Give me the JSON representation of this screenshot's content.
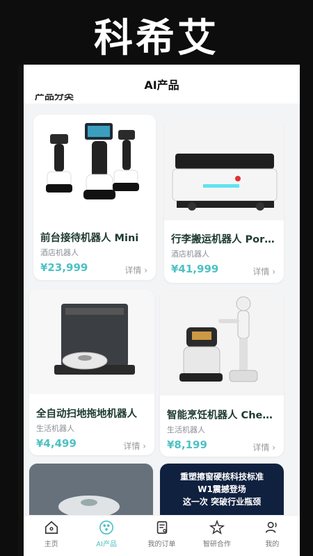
{
  "promo": {
    "title": "科希艾"
  },
  "header": {
    "title": "AI产品"
  },
  "section_peek": "产品分类",
  "colors": {
    "accent": "#4ec1c3",
    "name": "#1d3a2f"
  },
  "products": [
    {
      "name": "前台接待机器人 Mini",
      "category": "酒店机器人",
      "price": "¥23,999",
      "detail": "详情 ›"
    },
    {
      "name": "行李搬运机器人 Porter",
      "category": "酒店机器人",
      "price": "¥41,999",
      "detail": "详情 ›"
    },
    {
      "name": "全自动扫地拖地机器人",
      "category": "生活机器人",
      "price": "¥4,499",
      "detail": "详情 ›"
    },
    {
      "name": "智能烹饪机器人 Chef Pro",
      "category": "生活机器人",
      "price": "¥8,199",
      "detail": "详情 ›"
    }
  ],
  "banner": {
    "line1": "重塑擦窗硬核科技标准",
    "line2": "W1震撼登场",
    "line3": "这一次 突破行业瓶颈"
  },
  "tabs": [
    {
      "label": "主页",
      "icon": "home-icon"
    },
    {
      "label": "AI产品",
      "icon": "ai-products-icon"
    },
    {
      "label": "我的订单",
      "icon": "orders-icon"
    },
    {
      "label": "智研合作",
      "icon": "cooperation-icon"
    },
    {
      "label": "我的",
      "icon": "profile-icon"
    }
  ]
}
